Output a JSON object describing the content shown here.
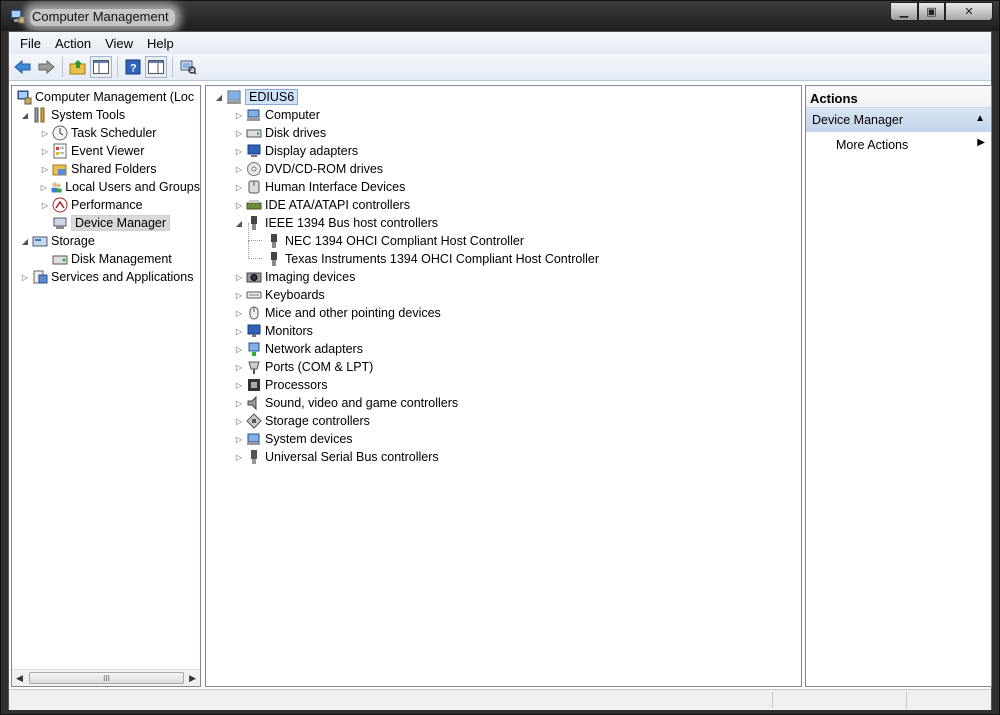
{
  "window": {
    "title": "Computer Management"
  },
  "caption": {
    "minimize": "▁",
    "maximize": "▣",
    "close": "✕"
  },
  "menu": [
    "File",
    "Action",
    "View",
    "Help"
  ],
  "toolbar_icons": [
    "back-arrow-icon",
    "forward-arrow-icon",
    "up-folder-icon",
    "show-hide-tree-icon",
    "help-icon",
    "action-pane-icon",
    "scan-hardware-icon"
  ],
  "left_tree": {
    "root": "Computer Management (Loc",
    "system_tools": "System Tools",
    "task_scheduler": "Task Scheduler",
    "event_viewer": "Event Viewer",
    "shared_folders": "Shared Folders",
    "local_users": "Local Users and Groups",
    "performance": "Performance",
    "device_manager": "Device Manager",
    "storage": "Storage",
    "disk_management": "Disk Management",
    "services": "Services and Applications",
    "scroll_grip": "III"
  },
  "device_tree": {
    "root": "EDIUS6",
    "categories": [
      "Computer",
      "Disk drives",
      "Display adapters",
      "DVD/CD-ROM drives",
      "Human Interface Devices",
      "IDE ATA/ATAPI controllers",
      "IEEE 1394 Bus host controllers",
      "Imaging devices",
      "Keyboards",
      "Mice and other pointing devices",
      "Monitors",
      "Network adapters",
      "Ports (COM & LPT)",
      "Processors",
      "Sound, video and game controllers",
      "Storage controllers",
      "System devices",
      "Universal Serial Bus controllers"
    ],
    "ieee_children": [
      "NEC 1394 OHCI Compliant Host Controller",
      "Texas Instruments 1394 OHCI Compliant Host Controller"
    ]
  },
  "actions": {
    "header": "Actions",
    "section": "Device Manager",
    "more_actions": "More Actions"
  }
}
